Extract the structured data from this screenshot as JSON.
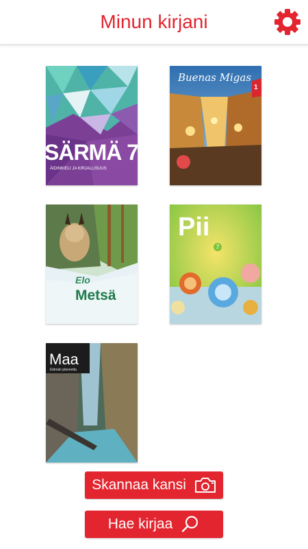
{
  "header": {
    "title": "Minun kirjani",
    "settings_icon": "gear-icon"
  },
  "books": [
    {
      "title": "SÄRMÄ 7",
      "subtitle": "ÄIDINKIELI JA KIRJALLISUUS"
    },
    {
      "title": "Buenas Migas",
      "number": "1"
    },
    {
      "title": "Metsä",
      "series": "Elo"
    },
    {
      "title": "Pii",
      "number": "7"
    },
    {
      "title": "Maa",
      "subtitle": "Elämän planeetta"
    }
  ],
  "buttons": {
    "scan_cover": "Skannaa kansi",
    "scan_icon": "camera-icon",
    "search_book": "Hae kirjaa",
    "search_icon": "search-icon"
  },
  "colors": {
    "accent": "#e2252f"
  }
}
